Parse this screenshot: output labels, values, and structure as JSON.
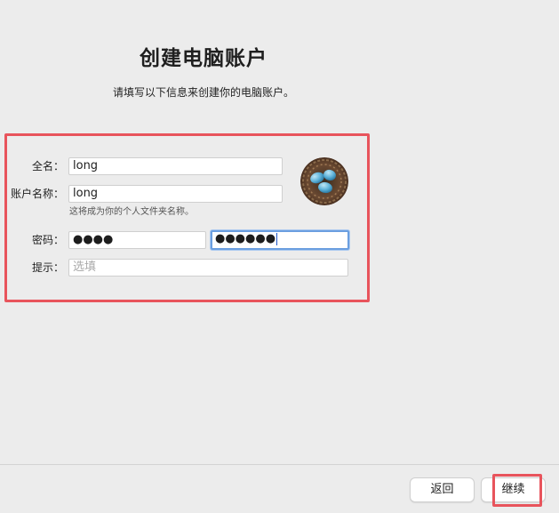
{
  "header": {
    "title": "创建电脑账户",
    "subtitle": "请填写以下信息来创建你的电脑账户。"
  },
  "form": {
    "full_name": {
      "label": "全名：",
      "value": "long"
    },
    "account_name": {
      "label": "账户名称：",
      "value": "long",
      "hint": "这将成为你的个人文件夹名称。"
    },
    "password": {
      "label": "密码：",
      "value": "●●●●",
      "verify_value": "●●●●●●"
    },
    "hint": {
      "label": "提示：",
      "placeholder": "选填"
    }
  },
  "avatar": {
    "icon": "bird-eggs-in-nest"
  },
  "footer": {
    "back_label": "返回",
    "continue_label": "继续"
  },
  "colors": {
    "highlight": "#e8545c",
    "focus_ring": "#6b9fe0",
    "background": "#ececec"
  }
}
